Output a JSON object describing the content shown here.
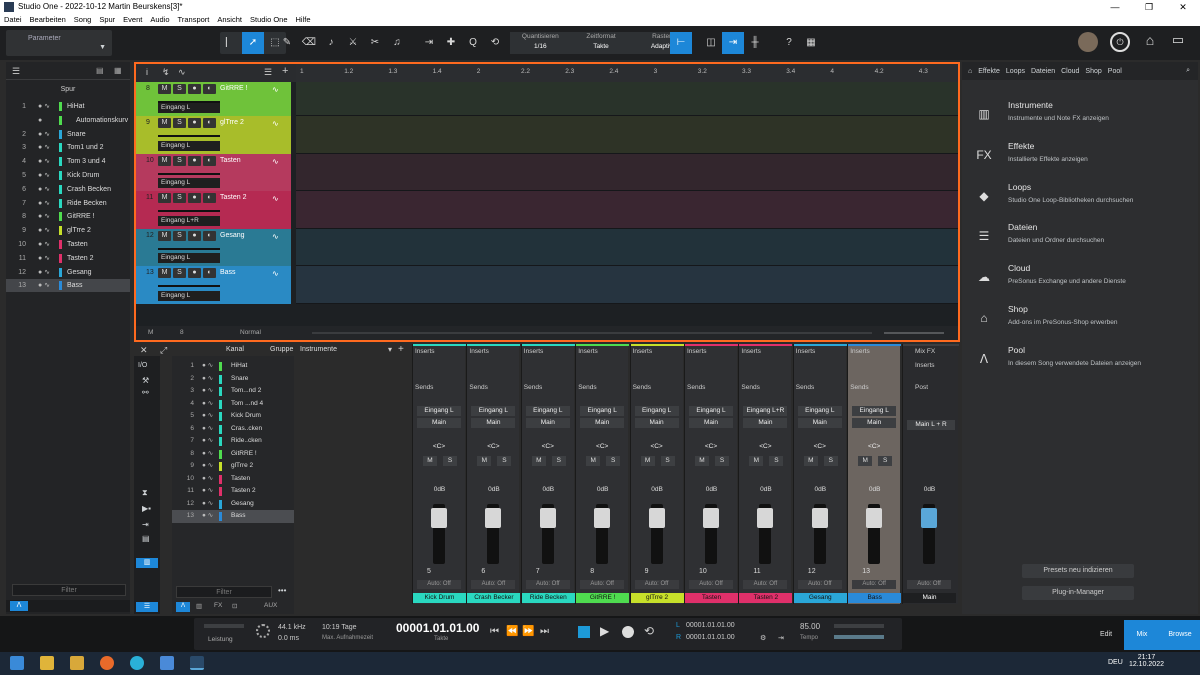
{
  "window": {
    "title": "Studio One - 2022-10-12 Martin Beurskens[3]*",
    "controls": [
      "—",
      "❐",
      "✕"
    ]
  },
  "menu": [
    "Datei",
    "Bearbeiten",
    "Song",
    "Spur",
    "Event",
    "Audio",
    "Transport",
    "Ansicht",
    "Studio One",
    "Hilfe"
  ],
  "toolbar": {
    "parameter_label": "Parameter",
    "quantize": {
      "label": "Quantisieren",
      "value": "1/16"
    },
    "timebase": {
      "label": "Zeitformat",
      "value": "Takte"
    },
    "snap": {
      "label": "Raster",
      "value": "Adaptiv"
    },
    "help": "?"
  },
  "tracklist": {
    "title": "Spur",
    "filter": "Filter",
    "tracks": [
      {
        "n": "1",
        "label": "HiHat",
        "color": "#4fdc4f"
      },
      {
        "n": "",
        "label": "Automationskurv",
        "color": "#4fdc4f"
      },
      {
        "n": "2",
        "label": "Snare",
        "color": "#2aa7d8"
      },
      {
        "n": "3",
        "label": "Tom1 und 2",
        "color": "#2ad8c0"
      },
      {
        "n": "4",
        "label": "Tom 3 und 4",
        "color": "#2ad8c0"
      },
      {
        "n": "5",
        "label": "Kick Drum",
        "color": "#2ad8c0"
      },
      {
        "n": "6",
        "label": "Crash Becken",
        "color": "#2ad8c0"
      },
      {
        "n": "7",
        "label": "Ride Becken",
        "color": "#2ad8c0"
      },
      {
        "n": "8",
        "label": "GitRRE !",
        "color": "#4fdc4f"
      },
      {
        "n": "9",
        "label": "glTrre 2",
        "color": "#c7e02a"
      },
      {
        "n": "10",
        "label": "Tasten",
        "color": "#e0306a"
      },
      {
        "n": "11",
        "label": "Tasten 2",
        "color": "#e0306a"
      },
      {
        "n": "12",
        "label": "Gesang",
        "color": "#2aa7d8"
      },
      {
        "n": "13",
        "label": "Bass",
        "color": "#2a8ad8"
      }
    ]
  },
  "arrange": {
    "ruler": [
      "1",
      "1.2",
      "1.3",
      "1.4",
      "2",
      "2.2",
      "2.3",
      "2.4",
      "3",
      "3.2",
      "3.3",
      "3.4",
      "4",
      "4.2",
      "4.3"
    ],
    "footer_m": "M",
    "footer_s": "8",
    "footer_mode": "Normal",
    "tracks": [
      {
        "num": "8",
        "name": "GitRRE !",
        "input": "Eingang L",
        "color": "#6fc23a",
        "lane": "#29332a"
      },
      {
        "num": "9",
        "name": "glTrre 2",
        "input": "Eingang L",
        "color": "#a8bd2a",
        "lane": "#2e3326"
      },
      {
        "num": "10",
        "name": "Tasten",
        "input": "Eingang L",
        "color": "#b53a5e",
        "lane": "#33262d"
      },
      {
        "num": "11",
        "name": "Tasten 2",
        "input": "Eingang L+R",
        "color": "#b52a52",
        "lane": "#3a2631"
      },
      {
        "num": "12",
        "name": "Gesang",
        "input": "Eingang L",
        "color": "#2a7a94",
        "lane": "#22323a"
      },
      {
        "num": "13",
        "name": "Bass",
        "input": "Eingang L",
        "color": "#2a8ac4",
        "lane": "#263440"
      }
    ]
  },
  "mixer": {
    "header_kanal": "Kanal",
    "header_gruppe": "Gruppe",
    "header_instr": "Instrumente",
    "filter": "Filter",
    "list": [
      {
        "n": "1",
        "label": "HiHat",
        "color": "#4fdc4f"
      },
      {
        "n": "2",
        "label": "Snare",
        "color": "#2ad8c0"
      },
      {
        "n": "3",
        "label": "Tom...nd 2",
        "color": "#2ad8c0"
      },
      {
        "n": "4",
        "label": "Tom ...nd 4",
        "color": "#2ad8c0"
      },
      {
        "n": "5",
        "label": "Kick Drum",
        "color": "#2ad8c0"
      },
      {
        "n": "6",
        "label": "Cras..cken",
        "color": "#2ad8c0"
      },
      {
        "n": "7",
        "label": "Ride..cken",
        "color": "#2ad8c0"
      },
      {
        "n": "8",
        "label": "GitRRE !",
        "color": "#4fdc4f"
      },
      {
        "n": "9",
        "label": "glTrre 2",
        "color": "#c7e02a"
      },
      {
        "n": "10",
        "label": "Tasten",
        "color": "#e0306a"
      },
      {
        "n": "11",
        "label": "Tasten 2",
        "color": "#e0306a"
      },
      {
        "n": "12",
        "label": "Gesang",
        "color": "#2aa7d8"
      },
      {
        "n": "13",
        "label": "Bass",
        "color": "#2a8ad8"
      }
    ],
    "channels": [
      {
        "num": "5",
        "label": "Kick Drum",
        "input": "Eingang L",
        "color": "#2ad8c0"
      },
      {
        "num": "6",
        "label": "Crash Becker",
        "input": "Eingang L",
        "color": "#2ad8c0"
      },
      {
        "num": "7",
        "label": "Ride Becken",
        "input": "Eingang L",
        "color": "#2ad8c0"
      },
      {
        "num": "8",
        "label": "GitRRE !",
        "input": "Eingang L",
        "color": "#4fdc4f"
      },
      {
        "num": "9",
        "label": "glTrre 2",
        "input": "Eingang L",
        "color": "#c7e02a"
      },
      {
        "num": "10",
        "label": "Tasten",
        "input": "Eingang L",
        "color": "#e0306a"
      },
      {
        "num": "11",
        "label": "Tasten 2",
        "input": "Eingang L+R",
        "color": "#e0306a"
      },
      {
        "num": "12",
        "label": "Gesang",
        "input": "Eingang L",
        "color": "#2aa7d8"
      },
      {
        "num": "13",
        "label": "Bass",
        "input": "Eingang L",
        "color": "#2a8ad8"
      }
    ],
    "strip_text": {
      "inserts": "Inserts",
      "sends": "Sends",
      "main": "Main",
      "pan": "<C>",
      "db": "0dB",
      "auto": "Auto: Off",
      "m": "M",
      "s": "S"
    },
    "master": {
      "mixfx": "Mix FX",
      "inserts": "Inserts",
      "post": "Post",
      "out": "Main L + R",
      "db": "0dB",
      "auto": "Auto: Off",
      "label": "Main"
    }
  },
  "browser": {
    "tabs": [
      "Effekte",
      "Loops",
      "Dateien",
      "Cloud",
      "Shop",
      "Pool"
    ],
    "items": [
      {
        "icon": "piano-icon",
        "title": "Instrumente",
        "sub": "Instrumente und Note FX anzeigen"
      },
      {
        "icon": "fx-icon",
        "title": "Effekte",
        "sub": "Installierte Effekte anzeigen"
      },
      {
        "icon": "loops-icon",
        "title": "Loops",
        "sub": "Studio One Loop-Bibliotheken durchsuchen"
      },
      {
        "icon": "files-icon",
        "title": "Dateien",
        "sub": "Dateien und Ordner durchsuchen"
      },
      {
        "icon": "cloud-icon",
        "title": "Cloud",
        "sub": "PreSonus Exchange und andere Dienste"
      },
      {
        "icon": "shop-icon",
        "title": "Shop",
        "sub": "Add-ons im PreSonus-Shop erwerben"
      },
      {
        "icon": "pool-icon",
        "title": "Pool",
        "sub": "In diesem Song verwendete Dateien anzeigen"
      }
    ],
    "btn_reindex": "Presets neu indizieren",
    "btn_plugin": "Plug-in-Manager"
  },
  "transport": {
    "leistung": "Leistung",
    "samplerate": "44.1 kHz",
    "latency": "0.0 ms",
    "record_time": "10:19 Tage",
    "record_label": "Max. Aufnahmezeit",
    "position": "00001.01.01.00",
    "position_unit": "Takte",
    "loop_l": "00001.01.01.00",
    "loop_r": "00001.01.01.00",
    "loop_l_lbl": "L",
    "loop_r_lbl": "R",
    "tempo": "85.00",
    "tempo_label": "Tempo",
    "edit": "Edit",
    "mix": "Mix",
    "browse": "Browse"
  },
  "taskbar": {
    "time": "21:17",
    "date": "12.10.2022",
    "lang": "DEU"
  }
}
